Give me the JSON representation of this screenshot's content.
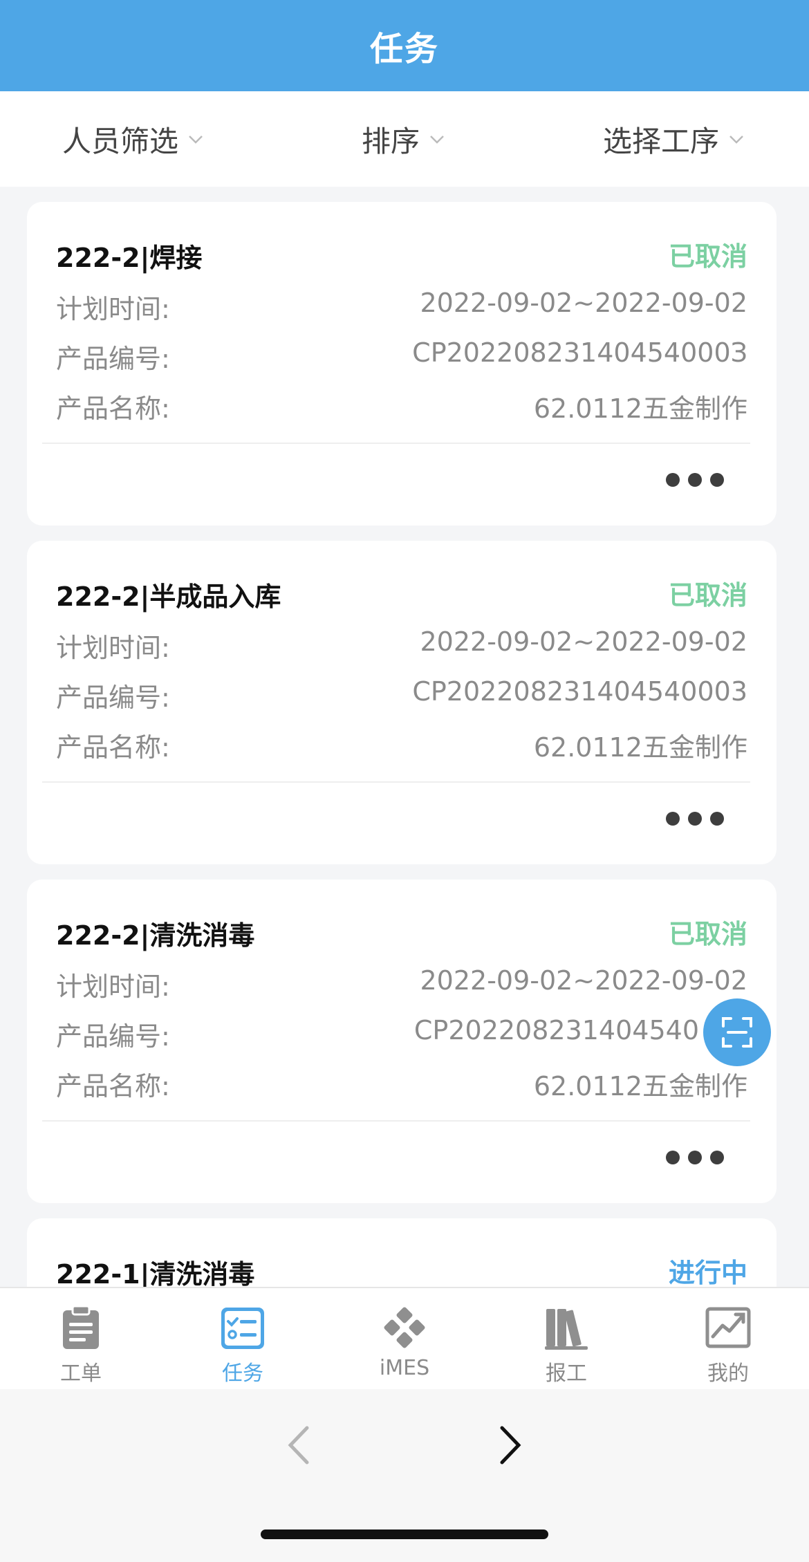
{
  "header": {
    "title": "任务"
  },
  "filters": [
    {
      "label": "人员筛选"
    },
    {
      "label": "排序"
    },
    {
      "label": "选择工序"
    }
  ],
  "labels": {
    "plan_time": "计划时间:",
    "product_code": "产品编号:",
    "product_name": "产品名称:"
  },
  "tasks": [
    {
      "title": "222-2|焊接",
      "status": "已取消",
      "plan_time": "2022-09-02~2022-09-02",
      "product_code": "CP20220823140454000З",
      "product_name": "62.0112五金制作"
    },
    {
      "title": "222-2|半成品入库",
      "status": "已取消",
      "plan_time": "2022-09-02~2022-09-02",
      "product_code": "CP202208231404540003",
      "product_name": "62.0112五金制作"
    },
    {
      "title": "222-2|清洗消毒",
      "status": "已取消",
      "plan_time": "2022-09-02~2022-09-02",
      "product_code": "CP202208231404540",
      "product_name": "62.0112五金制作"
    },
    {
      "title": "222-1|清洗消毒",
      "status": "进行中"
    }
  ],
  "tabs": [
    {
      "label": "工单",
      "icon": "clipboard-icon"
    },
    {
      "label": "任务",
      "icon": "task-checklist-icon",
      "active": true
    },
    {
      "label": "iMES",
      "icon": "gamepad-icon"
    },
    {
      "label": "报工",
      "icon": "books-icon"
    },
    {
      "label": "我的",
      "icon": "chart-trend-icon"
    }
  ],
  "colors": {
    "primary": "#4ea6e6",
    "status_cancelled": "#7cd0a2",
    "status_in_progress": "#4ea6e6"
  }
}
